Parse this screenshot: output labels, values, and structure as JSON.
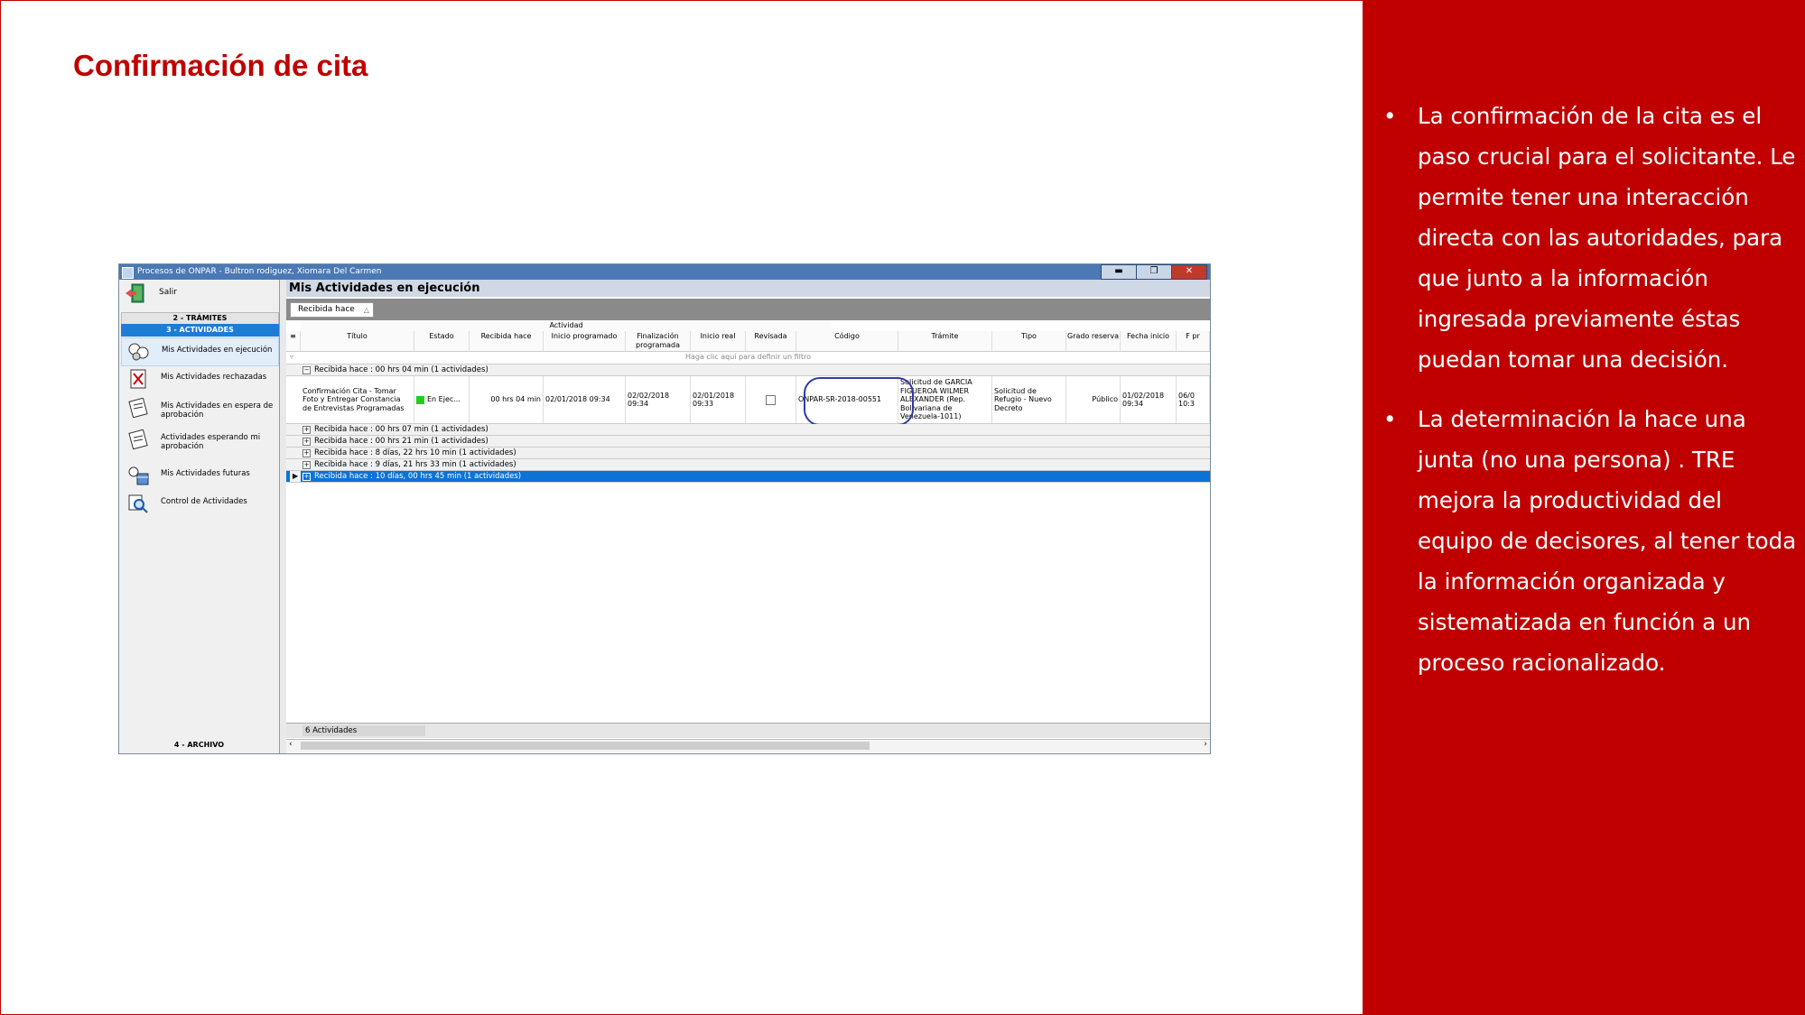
{
  "slide": {
    "title": "Confirmación de cita",
    "bullets": [
      "La confirmación de la cita es el paso crucial para el solicitante. Le permite tener una interacción directa con las autoridades, para que junto a la información ingresada previamente éstas puedan tomar una decisión.",
      "La determinación la hace una junta (no una persona) . TRE mejora la productividad del equipo de decisores, al tener toda la información organizada y sistematizada en función a un proceso racionalizado."
    ],
    "accent_color": "#c00000"
  },
  "window": {
    "title": "Procesos de ONPAR - Bultron rodiguez, Xiomara Del Carmen",
    "minimize": "▬",
    "restore": "❐",
    "close": "✕"
  },
  "nav": {
    "exit_label": "Salir",
    "sec_tramites": "2 - TRÁMITES",
    "sec_actividades": "3 - ACTIVIDADES",
    "sec_archivo": "4 - ARCHIVO",
    "items": [
      {
        "label": "Mis Actividades en ejecución",
        "icon": "activities-running-icon"
      },
      {
        "label": "Mis Actividades rechazadas",
        "icon": "rejected-icon"
      },
      {
        "label": "Mis Actividades en espera de aprobación",
        "icon": "pending-approval-icon"
      },
      {
        "label": "Actividades esperando mi aprobación",
        "icon": "awaiting-my-approval-icon"
      },
      {
        "label": "Mis Actividades futuras",
        "icon": "calendar-icon"
      },
      {
        "label": "Control de Actividades",
        "icon": "magnifier-icon"
      }
    ]
  },
  "main": {
    "title": "Mis Actividades en ejecución",
    "group_chip": "Recibida hace",
    "group_sort": "△",
    "activity_header": "Actividad",
    "columns": [
      "Título",
      "Estado",
      "Recibida hace",
      "Inicio programado",
      "Finalización programada",
      "Inicio real",
      "Revisada",
      "Código",
      "Trámite",
      "Tipo",
      "Grado reserva",
      "Fecha inicio",
      "F pr"
    ],
    "filter_hint": "Haga clic aquí para definir un filtro",
    "groups": [
      "Recibida hace : 00 hrs 04 min (1 actividades)",
      "Recibida hace : 00 hrs 07 min (1 actividades)",
      "Recibida hace : 00 hrs 21 min (1 actividades)",
      "Recibida hace : 8 días, 22 hrs 10 min (1 actividades)",
      "Recibida hace : 9 días, 21 hrs 33 min (1 actividades)",
      "Recibida hace : 10 días, 00 hrs 45 min (1 actividades)"
    ],
    "row": {
      "titulo": "Confirmación Cita - Tomar Foto y Entregar Constancia de Entrevistas Programadas",
      "estado": "En Ejec...",
      "recibida": "00 hrs 04 min",
      "inicio_prog": "02/01/2018 09:34",
      "fin_prog": "02/02/2018 09:34",
      "inicio_real": "02/01/2018 09:33",
      "codigo": "ONPAR-SR-2018-00551",
      "tramite": "Solicitud de GARCIA FIGUEROA WILMER ALEXANDER (Rep. Bolivariana de Venezuela-1011)",
      "tipo": "Solicitud de Refugio - Nuevo Decreto",
      "grado": "Público",
      "fecha_inicio": "01/02/2018 09:34",
      "f_pr": "06/0 10:3"
    },
    "footer_count": "6 Actividades"
  }
}
